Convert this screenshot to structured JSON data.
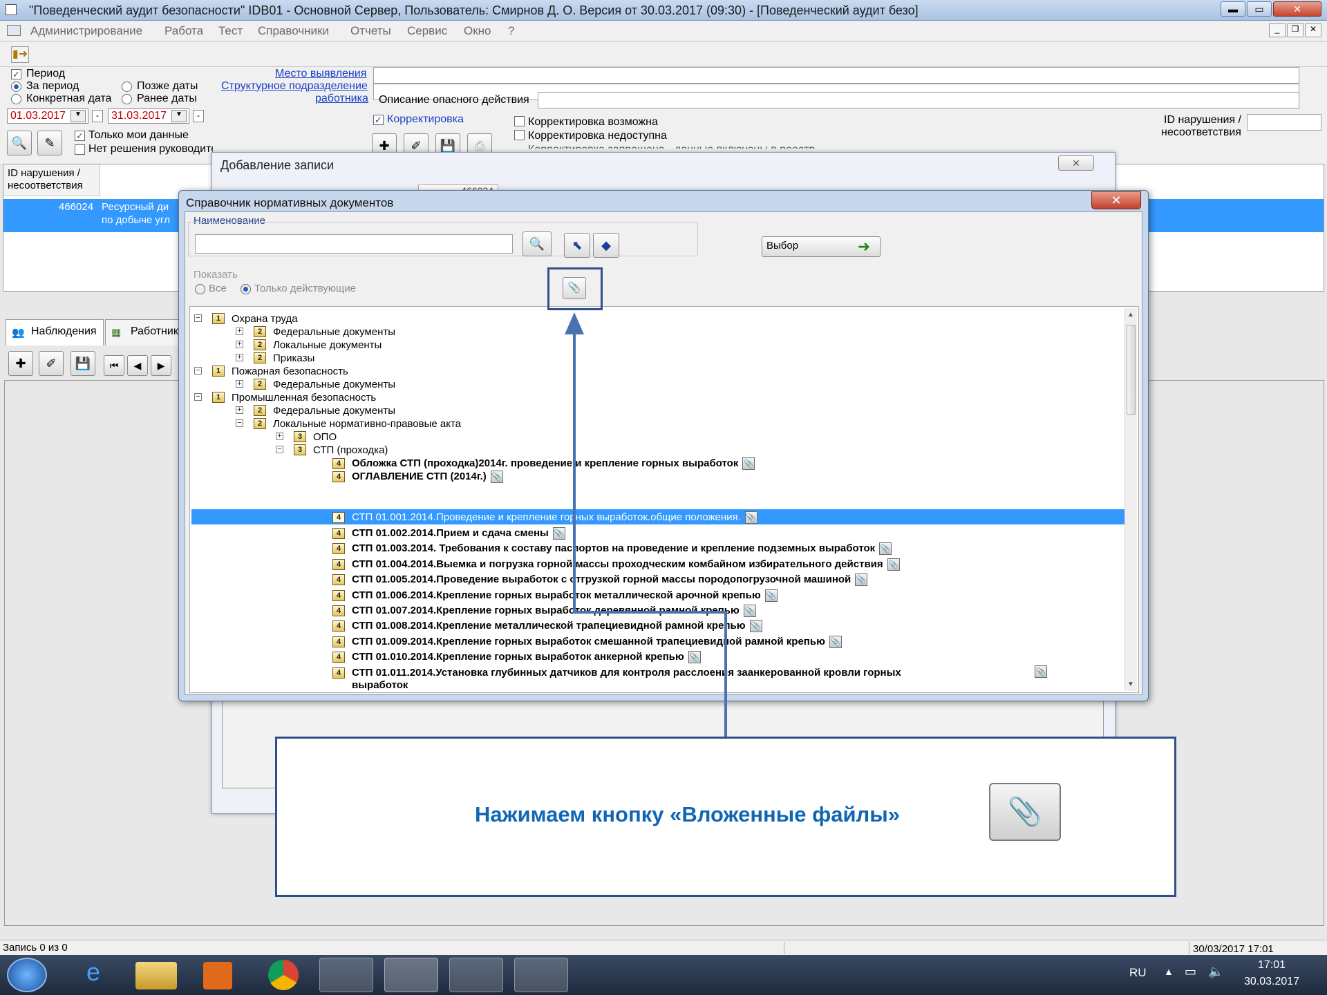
{
  "window": {
    "title": "\"Поведенческий аудит безопасности\"   IDB01 - Основной Сервер,   Пользователь: Смирнов Д. О.   Версия от 30.03.2017 (09:30) - [Поведенческий аудит безо]",
    "min_label": "▬",
    "max_label": "▭",
    "close_label": "✕"
  },
  "menu": [
    "Администрирование",
    "Работа",
    "Тест",
    "Справочники",
    "Отчеты",
    "Сервис",
    "Окно",
    "?"
  ],
  "filter": {
    "period_label": "Период",
    "radio_period": "За период",
    "radio_concrete": "Конкретная дата",
    "radio_after": "Позже даты",
    "radio_before": "Ранее даты",
    "date_from": "01.03.2017",
    "date_to": "31.03.2017",
    "link_place": "Место выявления",
    "link_struct": "Структурное подразделение",
    "link_worker": "работника",
    "desc_label": "Описание опасного действия",
    "correction_label": "Корректировка",
    "corr_possible": "Корректировка возможна",
    "corr_unavailable": "Корректировка недоступна",
    "corr_forbidden": "Корректировка запрещена - данные включены в реестр",
    "only_mine": "Только мои данные",
    "no_decision": "Нет решения руководителя",
    "id_violation_line1": "ID нарушения /",
    "id_violation_line2": "несоответствия"
  },
  "grid": {
    "header_line1": "ID нарушения /",
    "header_line2": "несоответствия",
    "row_id": "466024",
    "row_text1": "Ресурсный ди",
    "row_text2": "по добыче угл"
  },
  "tabs": [
    "Наблюдения",
    "Работники"
  ],
  "add_dialog": {
    "title": "Добавление записи",
    "close_label": "✕",
    "id_value": "466024"
  },
  "dialog": {
    "title": "Справочник нормативных документов",
    "close_label": "✕",
    "name_group": "Наименование",
    "choose_label": "Выбор",
    "show_group": "Показать",
    "radio_all": "Все",
    "radio_active": "Только действующие"
  },
  "tree": {
    "n1": "Охрана труда",
    "n1a": "Федеральные документы",
    "n1b": "Локальные документы",
    "n1c": "Приказы",
    "n2": "Пожарная безопасность",
    "n2a": "Федеральные документы",
    "n3": "Промышленная безопасность",
    "n3a": "Федеральные документы",
    "n3b": "Локальные нормативно-правовые акта",
    "n3b1": "ОПО",
    "n3b2": "СТП (проходка)",
    "docs": [
      "Обложка СТП (проходка)2014г. проведение и крепление горных выработок",
      "ОГЛАВЛЕНИЕ СТП (2014г.)",
      "СТП 01.001.2014.Проведение и крепление горных выработок.общие положения.",
      "СТП 01.002.2014.Прием и сдача смены",
      "СТП 01.003.2014.  Требования к составу паспортов на проведение и крепление подземных выработок",
      "СТП 01.004.2014.Выемка и погрузка горной массы проходческим комбайном избирательного действия",
      "СТП 01.005.2014.Проведение выработок с отгрузкой горной массы породопогрузочной машиной",
      "СТП 01.006.2014.Крепление горных выработок металлической арочной крепью",
      "СТП 01.007.2014.Крепление горных выработок деревянной рамной крепью",
      "СТП 01.008.2014.Крепление металлической трапециевидной рамной крепью",
      "СТП 01.009.2014.Крепление горных выработок смешанной трапециевидной рамной крепью",
      "СТП 01.010.2014.Крепление горных выработок анкерной крепью",
      "СТП 01.011.2014.Установка глубинных датчиков для контроля расслоения заанкерованной кровли горных"
    ],
    "doc_last_cont": "выработок"
  },
  "callout": {
    "text": "Нажимаем кнопку «Вложенные файлы»"
  },
  "status": {
    "record": "Запись  0  из  0",
    "datetime": "30/03/2017 17:01"
  },
  "taskbar": {
    "lang": "RU",
    "time": "17:01",
    "date": "30.03.2017"
  },
  "colors": {
    "selection": "#3399ff",
    "callout_text": "#1166b3",
    "callout_border": "#2e4f8a",
    "date_text": "#c00000"
  }
}
